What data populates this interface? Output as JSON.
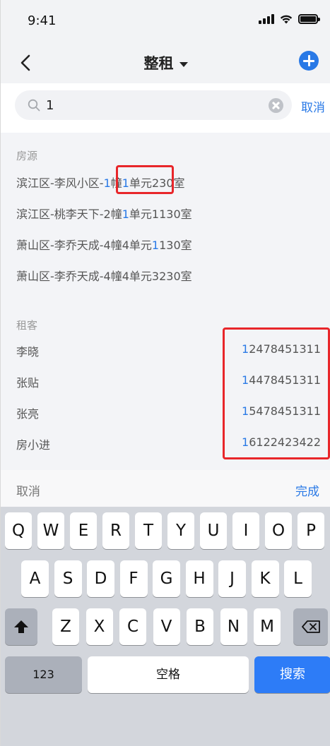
{
  "status_bar": {
    "time": "9:41"
  },
  "nav": {
    "title": "整租"
  },
  "search": {
    "value": "1",
    "cancel_label": "取消"
  },
  "houses": {
    "title": "房源",
    "items": [
      {
        "parts": [
          {
            "t": "滨江区-李风小区-",
            "h": false
          },
          {
            "t": "1",
            "h": true
          },
          {
            "t": "幢",
            "h": false
          },
          {
            "t": "1",
            "h": true
          },
          {
            "t": "单元",
            "h": false
          },
          {
            "t": "2",
            "h": false
          },
          {
            "t": "30室",
            "h": false
          }
        ]
      },
      {
        "parts": [
          {
            "t": "滨江区-桃李天下-2幢",
            "h": false
          },
          {
            "t": "1",
            "h": true
          },
          {
            "t": "单元1130室",
            "h": false
          }
        ]
      },
      {
        "parts": [
          {
            "t": "萧山区-李乔天成-4幢4单元",
            "h": false
          },
          {
            "t": "1",
            "h": true
          },
          {
            "t": "130室",
            "h": false
          }
        ]
      },
      {
        "parts": [
          {
            "t": "萧山区-李乔天成-4幢4单元3230室",
            "h": false
          }
        ]
      }
    ]
  },
  "tenants": {
    "title": "租客",
    "items": [
      {
        "name": "李晓",
        "phone_hl": "1",
        "phone_rest": "2478451311"
      },
      {
        "name": "张贴",
        "phone_hl": "1",
        "phone_rest": "4478451311"
      },
      {
        "name": "张亮",
        "phone_hl": "1",
        "phone_rest": "5478451311"
      },
      {
        "name": "房小进",
        "phone_hl": "1",
        "phone_rest": "6122423422"
      }
    ]
  },
  "toolbar": {
    "cancel_label": "取消",
    "done_label": "完成"
  },
  "keyboard": {
    "row1": [
      "Q",
      "W",
      "E",
      "R",
      "T",
      "Y",
      "U",
      "I",
      "O",
      "P"
    ],
    "row2": [
      "A",
      "S",
      "D",
      "F",
      "G",
      "H",
      "J",
      "K",
      "L"
    ],
    "row3": [
      "Z",
      "X",
      "C",
      "V",
      "B",
      "N",
      "M"
    ],
    "numbers_label": "123",
    "space_label": "空格",
    "search_label": "搜索"
  },
  "colors": {
    "accent": "#2979e6",
    "highlight_box": "#e8262a",
    "search_key": "#2d7cf7"
  }
}
